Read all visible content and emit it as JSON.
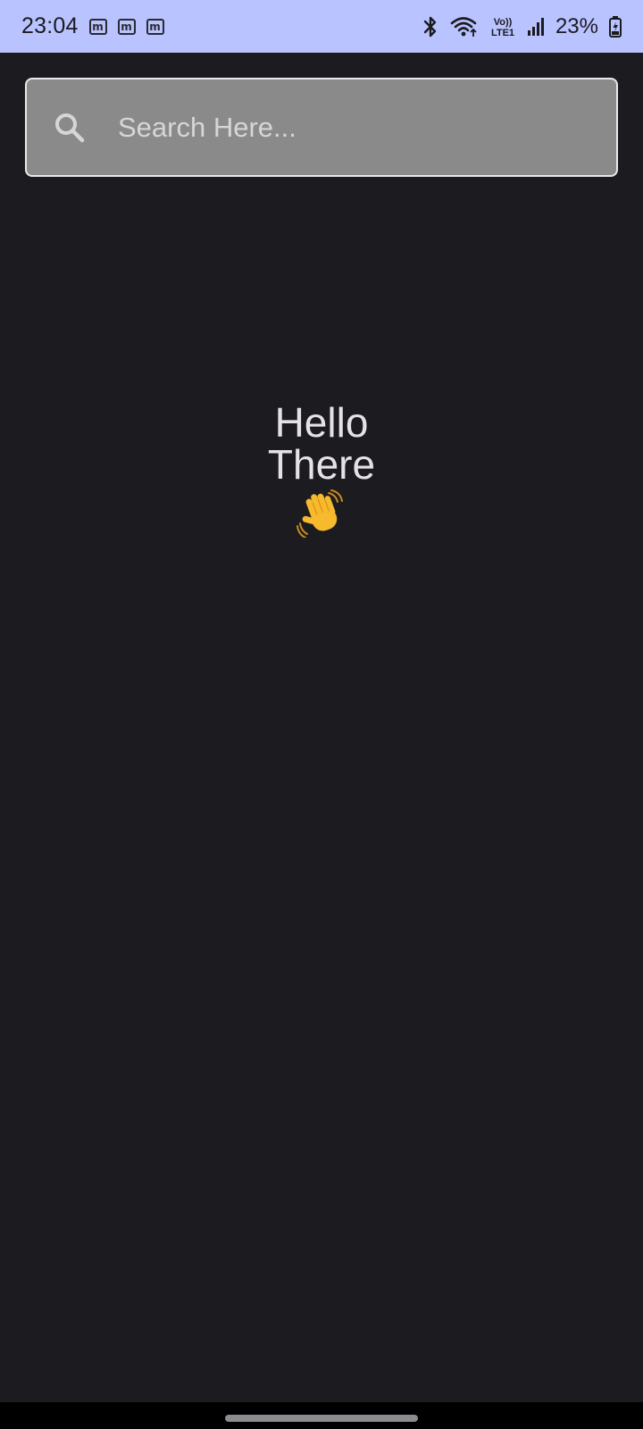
{
  "status_bar": {
    "time": "23:04",
    "notifications": [
      "m",
      "m",
      "m"
    ],
    "icons": [
      "bluetooth-icon",
      "wifi-icon",
      "volte-lte-icon",
      "signal-icon",
      "battery-icon"
    ],
    "lte_top": "Vo))",
    "lte_bottom": "LTE1",
    "battery_text": "23%",
    "background_color": "#b9c3ff"
  },
  "search": {
    "placeholder": "Search Here...",
    "value": "",
    "icon": "search-icon"
  },
  "greeting": {
    "line1": "Hello",
    "line2": "There",
    "emoji": "waving-hand-icon"
  },
  "colors": {
    "background": "#1c1b20",
    "search_fill": "#8a8a8a",
    "text": "#e6e1e6"
  }
}
